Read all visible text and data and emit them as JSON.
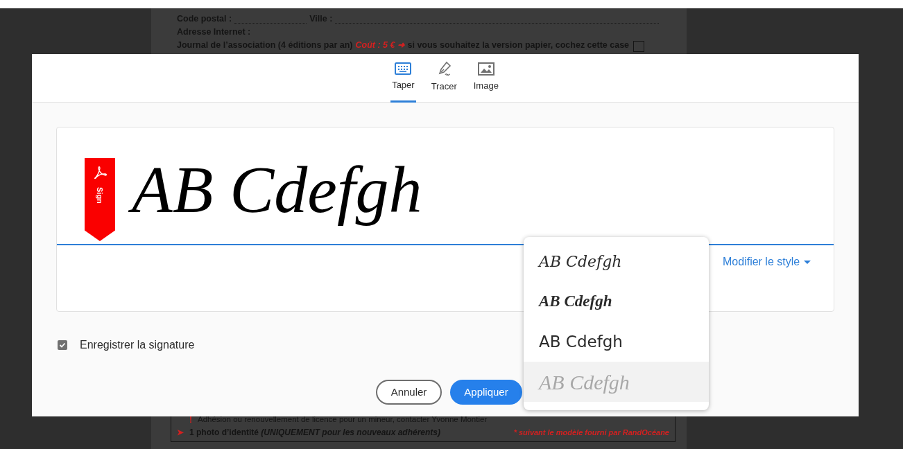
{
  "document": {
    "top_lines": [
      {
        "segments": [
          {
            "kind": "text",
            "text": "Code postal :"
          },
          {
            "kind": "leader"
          },
          {
            "kind": "text",
            "text": "Ville :"
          },
          {
            "kind": "leader"
          }
        ]
      },
      {
        "segments": [
          {
            "kind": "text",
            "text": "Adresse Internet :"
          }
        ]
      },
      {
        "segments": [
          {
            "kind": "text",
            "text": "Journal de l’association (4 éditions par an)"
          },
          {
            "kind": "red",
            "text": "Coût : 5 €"
          },
          {
            "kind": "red",
            "text": "➜"
          },
          {
            "kind": "text",
            "text": "si vous souhaitez la version papier, cochez cette case"
          },
          {
            "kind": "checkbox",
            "checked": false
          }
        ]
      }
    ],
    "bottom_lines": [
      {
        "marker": "!",
        "text": "Adhésion ou renouvellement de licence pour un mineur, contacter Yvonne Montier"
      },
      {
        "marker": "➤",
        "text": "1 photo d’identité *(UNIQUEMENT pour les nouveaux adhérents)*",
        "note": "* suivant le modèle fourni par RandOcéane"
      }
    ]
  },
  "dialog": {
    "tabs": [
      {
        "label": "Taper",
        "selected": true
      },
      {
        "label": "Tracer",
        "selected": false
      },
      {
        "label": "Image",
        "selected": false
      }
    ],
    "signature": {
      "text": "AB Cdefgh",
      "badge": "Sign"
    },
    "style_menu": {
      "label": "Modifier le style",
      "options": [
        {
          "text": "AB Cdefgh",
          "selected": false
        },
        {
          "text": "AB Cdefgh",
          "selected": false
        },
        {
          "text": "AB Cdefgh",
          "selected": false
        },
        {
          "text": "AB Cdefgh",
          "selected": true
        }
      ]
    },
    "save_signature": {
      "label": "Enregistrer la signature",
      "checked": true
    },
    "buttons": [
      {
        "label": "Annuler",
        "kind": "secondary"
      },
      {
        "label": "Appliquer",
        "kind": "primary"
      }
    ]
  }
}
